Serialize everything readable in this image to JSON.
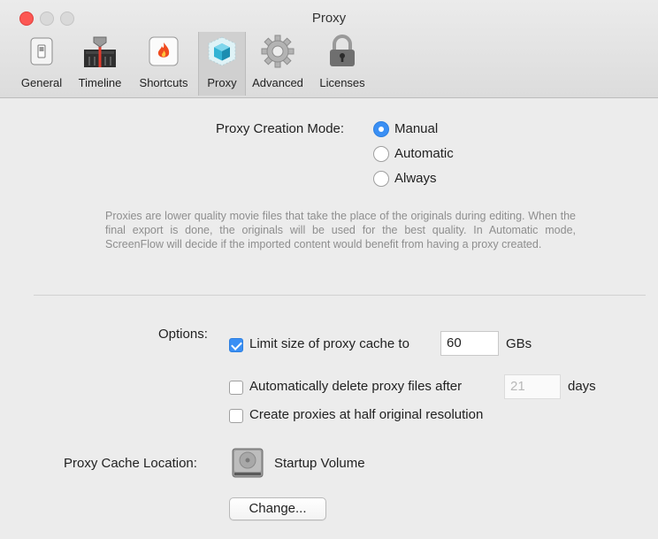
{
  "window": {
    "title": "Proxy"
  },
  "toolbar": {
    "items": [
      {
        "label": "General",
        "icon": "switch-icon"
      },
      {
        "label": "Timeline",
        "icon": "timeline-icon"
      },
      {
        "label": "Shortcuts",
        "icon": "flame-icon"
      },
      {
        "label": "Proxy",
        "icon": "cube-icon",
        "active": true
      },
      {
        "label": "Advanced",
        "icon": "gear-icon"
      },
      {
        "label": "Licenses",
        "icon": "padlock-icon"
      }
    ]
  },
  "proxy_mode": {
    "label": "Proxy Creation Mode:",
    "options": [
      {
        "label": "Manual",
        "selected": true
      },
      {
        "label": "Automatic",
        "selected": false
      },
      {
        "label": "Always",
        "selected": false
      }
    ]
  },
  "description": "Proxies are lower quality movie files that take the place of the originals during editing.  When the final export is done, the originals will be used for the best quality.  In Automatic mode, ScreenFlow will decide if the imported content would benefit from having a proxy created.",
  "options": {
    "label": "Options:",
    "limit_cache": {
      "label": "Limit size of proxy cache to",
      "checked": true,
      "value": "60",
      "unit": "GBs"
    },
    "auto_delete": {
      "label": "Automatically delete proxy files after",
      "checked": false,
      "placeholder": "21",
      "unit": "days"
    },
    "half_res": {
      "label": "Create proxies at half original resolution",
      "checked": false
    }
  },
  "cache_location": {
    "label": "Proxy Cache Location:",
    "volume": "Startup Volume",
    "change_button": "Change..."
  },
  "colors": {
    "accent": "#3a8ff4",
    "close": "#fc5753"
  }
}
